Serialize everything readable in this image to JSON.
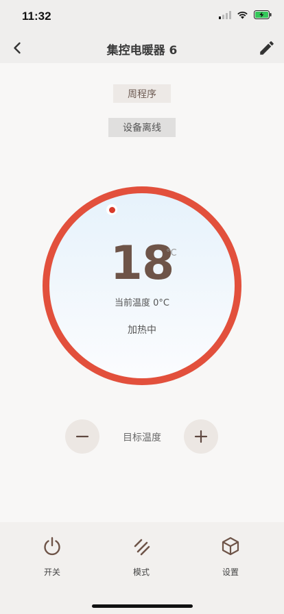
{
  "status_bar": {
    "time": "11:32"
  },
  "nav": {
    "title": "集控电暖器 6"
  },
  "chips": {
    "program": "周程序",
    "offline": "设备离线"
  },
  "dial": {
    "target_temp": "18",
    "unit": "°C",
    "current_temp": "当前温度 0°C",
    "status": "加热中",
    "accent_color": "#e2503c"
  },
  "target": {
    "label": "目标温度"
  },
  "tabs": [
    {
      "label": "开关",
      "icon": "power-icon"
    },
    {
      "label": "模式",
      "icon": "mode-icon"
    },
    {
      "label": "设置",
      "icon": "settings-cube-icon"
    }
  ]
}
